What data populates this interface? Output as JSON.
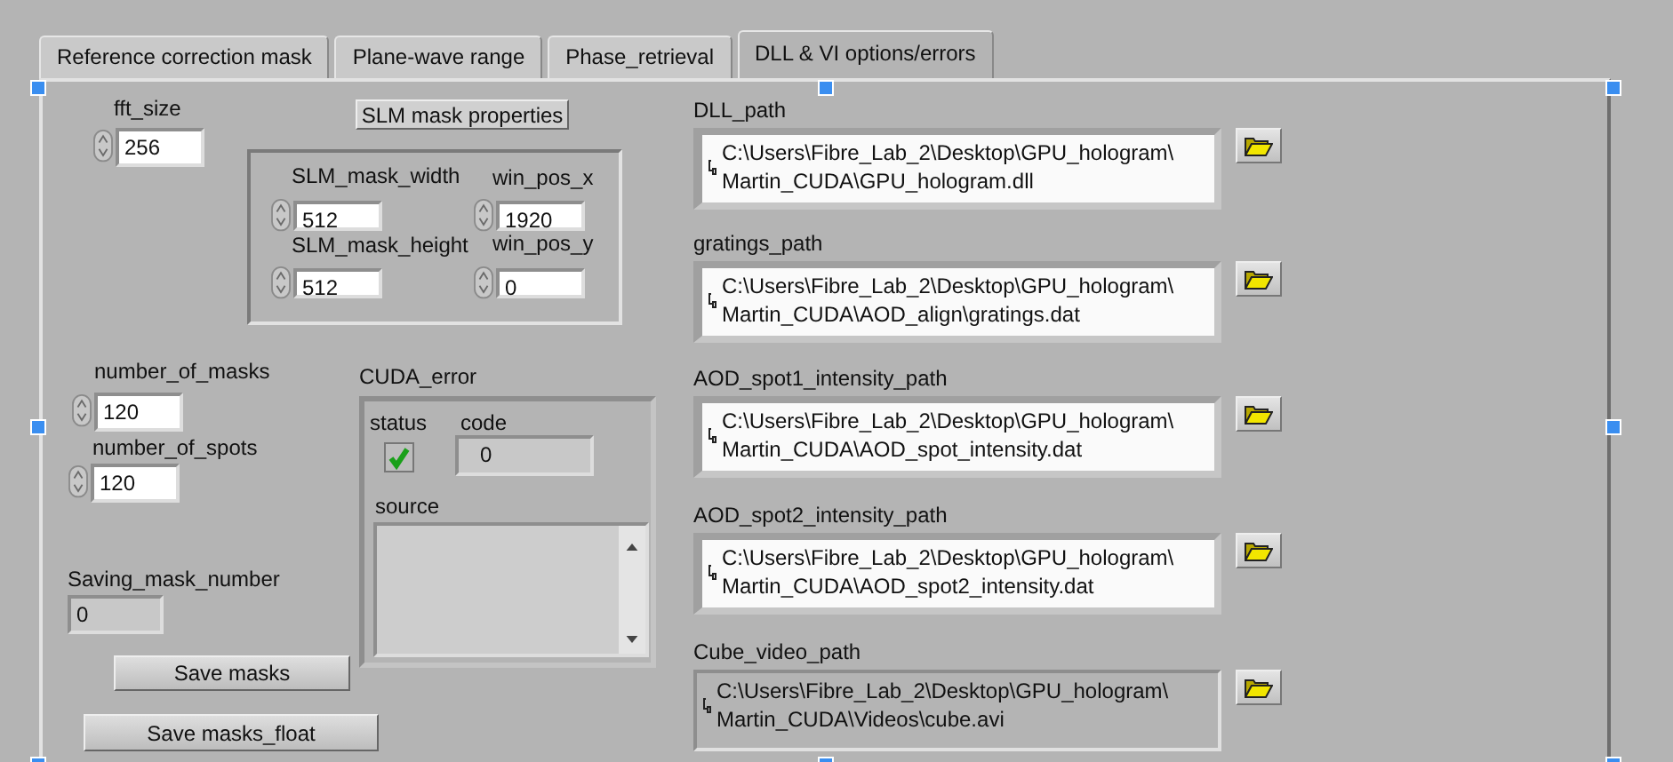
{
  "tabs": [
    {
      "label": "Reference correction mask",
      "selected": false
    },
    {
      "label": "Plane-wave range",
      "selected": false
    },
    {
      "label": "Phase_retrieval",
      "selected": false
    },
    {
      "label": "DLL & VI options/errors",
      "selected": true
    }
  ],
  "numerics": [
    {
      "label": "fft_size",
      "value": "256",
      "kind": "control"
    },
    {
      "label": "SLM_mask_width",
      "value": "512",
      "kind": "control"
    },
    {
      "label": "win_pos_x",
      "value": "1920",
      "kind": "control"
    },
    {
      "label": "SLM_mask_height",
      "value": "512",
      "kind": "control"
    },
    {
      "label": "win_pos_y",
      "value": "0",
      "kind": "control"
    },
    {
      "label": "number_of_masks",
      "value": "120",
      "kind": "control"
    },
    {
      "label": "number_of_spots",
      "value": "120",
      "kind": "control"
    },
    {
      "label": "Saving_mask_number",
      "value": "0",
      "kind": "indicator"
    }
  ],
  "properties_button": "SLM mask properties",
  "buttons": [
    "Save masks",
    "Save masks_float"
  ],
  "cuda_error": {
    "label": "CUDA_error",
    "status_label": "status",
    "error": false,
    "code_label": "code",
    "code": "0",
    "source_label": "source"
  },
  "paths": [
    {
      "label": "DLL_path",
      "lines": [
        "C:\\Users\\Fibre_Lab_2\\Desktop\\GPU_hologram\\",
        "Martin_CUDA\\GPU_hologram.dll"
      ],
      "kind": "control"
    },
    {
      "label": "gratings_path",
      "lines": [
        "C:\\Users\\Fibre_Lab_2\\Desktop\\GPU_hologram\\",
        "Martin_CUDA\\AOD_align\\gratings.dat"
      ],
      "kind": "control"
    },
    {
      "label": "AOD_spot1_intensity_path",
      "lines": [
        "C:\\Users\\Fibre_Lab_2\\Desktop\\GPU_hologram\\",
        "Martin_CUDA\\AOD_spot_intensity.dat"
      ],
      "kind": "control"
    },
    {
      "label": "AOD_spot2_intensity_path",
      "lines": [
        "C:\\Users\\Fibre_Lab_2\\Desktop\\GPU_hologram\\",
        "Martin_CUDA\\AOD_spot2_intensity.dat"
      ],
      "kind": "control"
    },
    {
      "label": "Cube_video_path",
      "lines": [
        "C:\\Users\\Fibre_Lab_2\\Desktop\\GPU_hologram\\",
        "Martin_CUDA\\Videos\\cube.avi"
      ],
      "kind": "indicator"
    }
  ]
}
